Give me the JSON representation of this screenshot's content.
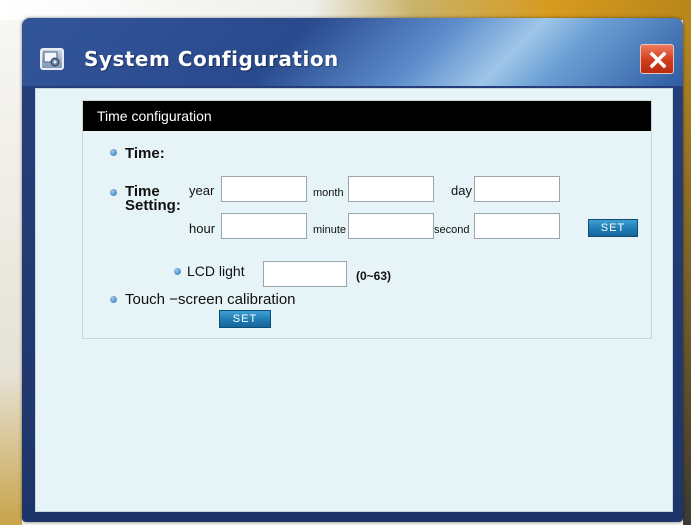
{
  "window": {
    "title": "System Configuration",
    "close_label": "✕"
  },
  "panel": {
    "header": "Time configuration"
  },
  "time": {
    "label": "Time:"
  },
  "time_setting": {
    "label_line1": "Time",
    "label_line2": "Setting:",
    "fields": {
      "year": {
        "label": "year",
        "value": ""
      },
      "month": {
        "label": "month",
        "value": ""
      },
      "day": {
        "label": "day",
        "value": ""
      },
      "hour": {
        "label": "hour",
        "value": ""
      },
      "minute": {
        "label": "minute",
        "value": ""
      },
      "second": {
        "label": "second",
        "value": ""
      }
    },
    "set_label": "SET"
  },
  "lcd_light": {
    "label": "LCD light",
    "value": "",
    "range": "(0~63)"
  },
  "touch_calibration": {
    "label": "Touch −screen calibration",
    "set_label": "SET"
  },
  "icons": [
    "settings-window-icon",
    "close-icon",
    "bullet-icon"
  ],
  "colors": {
    "titlebar": "#294a8d",
    "close": "#d13d1c",
    "panel_bg": "#e6f4f7",
    "header_bg": "#000000",
    "button": "#1e78b0"
  }
}
